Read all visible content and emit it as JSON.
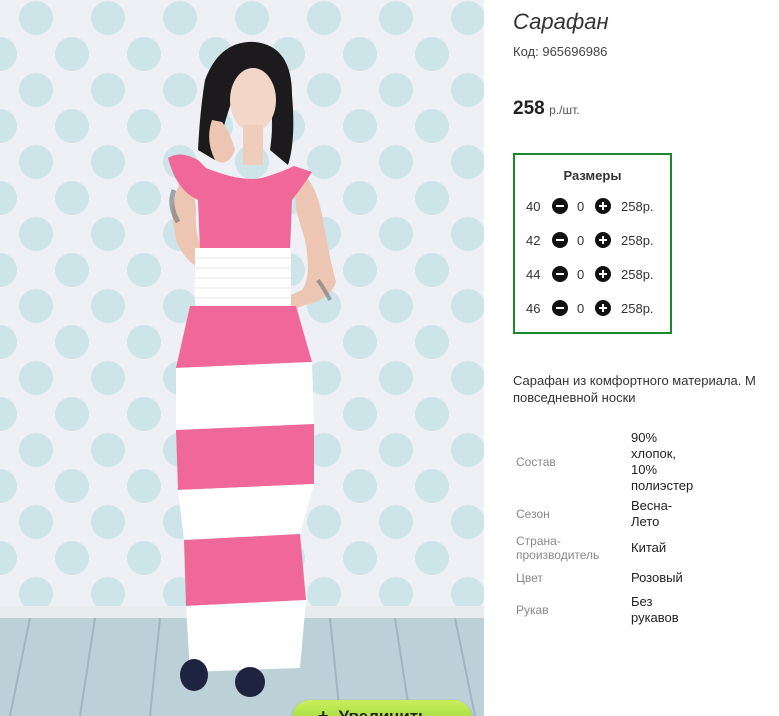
{
  "product": {
    "title": "Сарафан",
    "code_label": "Код:",
    "code_value": "965696986",
    "price_value": "258",
    "price_unit": "р./шт."
  },
  "image": {
    "zoom_button_label": "Увеличить",
    "zoom_icon": "plus-icon",
    "dress_colors": {
      "pink": "#f0689a",
      "white": "#ffffff"
    }
  },
  "sizes": {
    "title": "Размеры",
    "border_color": "#1c8a2c",
    "rows": [
      {
        "size": "40",
        "qty": "0",
        "price": "258р."
      },
      {
        "size": "42",
        "qty": "0",
        "price": "258р."
      },
      {
        "size": "44",
        "qty": "0",
        "price": "258р."
      },
      {
        "size": "46",
        "qty": "0",
        "price": "258р."
      }
    ]
  },
  "description": {
    "line1": "Сарафан из комфортного материала. М",
    "line2": "повседневной носки"
  },
  "attributes": [
    {
      "label": [
        "Состав"
      ],
      "value": [
        "90%",
        "хлопок,",
        "10%",
        "полиэстер"
      ]
    },
    {
      "label": [
        "Сезон"
      ],
      "value": [
        "Весна-",
        "Лето"
      ]
    },
    {
      "label": [
        "Страна-",
        "производитель"
      ],
      "value": [
        "Китай"
      ]
    },
    {
      "label": [
        "Цвет"
      ],
      "value": [
        "Розовый"
      ]
    },
    {
      "label": [
        "Рукав"
      ],
      "value": [
        "Без",
        "рукавов"
      ]
    }
  ]
}
